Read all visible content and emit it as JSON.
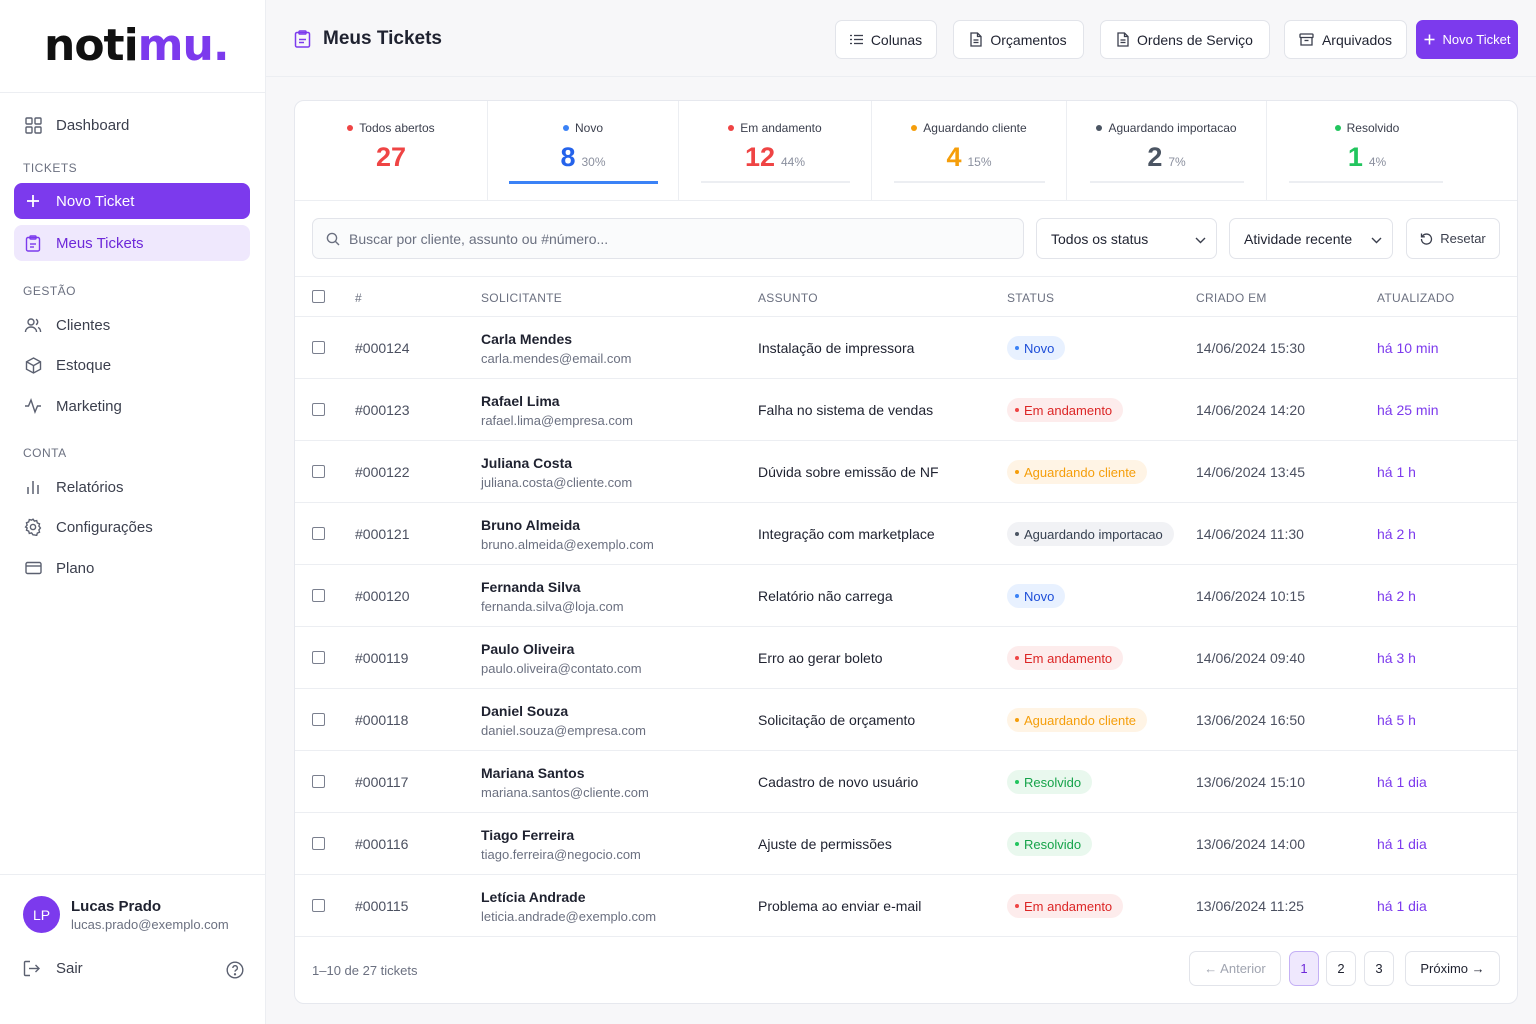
{
  "brand": {
    "logo_main": "noti",
    "logo_accent": "mu",
    "logo_dot": ".",
    "accent_color": "#7c3aed"
  },
  "sidebar": {
    "dashboard": "Dashboard",
    "section_tickets": "TICKETS",
    "novo_ticket": "Novo Ticket",
    "meus_tickets": "Meus Tickets",
    "section_gestao": "GESTÃO",
    "clientes": "Clientes",
    "estoque": "Estoque",
    "marketing": "Marketing",
    "section_conta": "CONTA",
    "relatorios": "Relatórios",
    "configuracoes": "Configurações",
    "plano": "Plano",
    "user": {
      "initials": "LP",
      "name": "Lucas Prado",
      "email": "lucas.prado@exemplo.com"
    },
    "logout": "Sair"
  },
  "header": {
    "title": "Meus Tickets",
    "buttons": {
      "colunas": "Colunas",
      "orcamentos": "Orçamentos",
      "ordens": "Ordens de Serviço",
      "arquivados": "Arquivados",
      "novo": "Novo Ticket"
    }
  },
  "stats": [
    {
      "label": "Todos abertos",
      "value": "27",
      "pct": "",
      "color": "#ef4444"
    },
    {
      "label": "Novo",
      "value": "8",
      "pct": "30%",
      "color": "#3b82f6"
    },
    {
      "label": "Em andamento",
      "value": "12",
      "pct": "44%",
      "color": "#ef4444"
    },
    {
      "label": "Aguardando cliente",
      "value": "4",
      "pct": "15%",
      "color": "#f59e0b"
    },
    {
      "label": "Aguardando importacao",
      "value": "2",
      "pct": "7%",
      "color": "#4b5563"
    },
    {
      "label": "Resolvido",
      "value": "1",
      "pct": "4%",
      "color": "#22c55e"
    }
  ],
  "filters": {
    "search_placeholder": "Buscar por cliente, assunto ou #número...",
    "status_select": "Todos os status",
    "sort_select": "Atividade recente",
    "reset": "Resetar"
  },
  "table": {
    "columns": [
      "#",
      "SOLICITANTE",
      "ASSUNTO",
      "STATUS",
      "CRIADO EM",
      "ATUALIZADO"
    ],
    "rows": [
      {
        "id": "#000124",
        "name": "Carla Mendes",
        "email": "carla.mendes@email.com",
        "subject": "Instalação de impressora",
        "status": "Novo",
        "status_kind": "novo",
        "created": "14/06/2024 15:30",
        "updated": "há 10 min"
      },
      {
        "id": "#000123",
        "name": "Rafael Lima",
        "email": "rafael.lima@empresa.com",
        "subject": "Falha no sistema de vendas",
        "status": "Em andamento",
        "status_kind": "andamento",
        "created": "14/06/2024 14:20",
        "updated": "há 25 min"
      },
      {
        "id": "#000122",
        "name": "Juliana Costa",
        "email": "juliana.costa@cliente.com",
        "subject": "Dúvida sobre emissão de NF",
        "status": "Aguardando cliente",
        "status_kind": "cliente",
        "created": "14/06/2024 13:45",
        "updated": "há 1 h"
      },
      {
        "id": "#000121",
        "name": "Bruno Almeida",
        "email": "bruno.almeida@exemplo.com",
        "subject": "Integração com marketplace",
        "status": "Aguardando importacao",
        "status_kind": "importacao",
        "created": "14/06/2024 11:30",
        "updated": "há 2 h"
      },
      {
        "id": "#000120",
        "name": "Fernanda Silva",
        "email": "fernanda.silva@loja.com",
        "subject": "Relatório não carrega",
        "status": "Novo",
        "status_kind": "novo",
        "created": "14/06/2024 10:15",
        "updated": "há 2 h"
      },
      {
        "id": "#000119",
        "name": "Paulo Oliveira",
        "email": "paulo.oliveira@contato.com",
        "subject": "Erro ao gerar boleto",
        "status": "Em andamento",
        "status_kind": "andamento",
        "created": "14/06/2024 09:40",
        "updated": "há 3 h"
      },
      {
        "id": "#000118",
        "name": "Daniel Souza",
        "email": "daniel.souza@empresa.com",
        "subject": "Solicitação de orçamento",
        "status": "Aguardando cliente",
        "status_kind": "cliente",
        "created": "13/06/2024 16:50",
        "updated": "há 5 h"
      },
      {
        "id": "#000117",
        "name": "Mariana Santos",
        "email": "mariana.santos@cliente.com",
        "subject": "Cadastro de novo usuário",
        "status": "Resolvido",
        "status_kind": "resolvido",
        "created": "13/06/2024 15:10",
        "updated": "há 1 dia"
      },
      {
        "id": "#000116",
        "name": "Tiago Ferreira",
        "email": "tiago.ferreira@negocio.com",
        "subject": "Ajuste de permissões",
        "status": "Resolvido",
        "status_kind": "resolvido",
        "created": "13/06/2024 14:00",
        "updated": "há 1 dia"
      },
      {
        "id": "#000115",
        "name": "Letícia Andrade",
        "email": "leticia.andrade@exemplo.com",
        "subject": "Problema ao enviar e-mail",
        "status": "Em andamento",
        "status_kind": "andamento",
        "created": "13/06/2024 11:25",
        "updated": "há 1 dia"
      }
    ]
  },
  "status_styles": {
    "novo": {
      "bg": "#e8f1ff",
      "fg": "#1d4ed8",
      "dot": "#3b82f6"
    },
    "andamento": {
      "bg": "#fdecec",
      "fg": "#dc2626",
      "dot": "#ef4444"
    },
    "cliente": {
      "bg": "#fff4e5",
      "fg": "#f59e0b",
      "dot": "#f59e0b"
    },
    "importacao": {
      "bg": "#f1f2f5",
      "fg": "#374151",
      "dot": "#4b5563"
    },
    "resolvido": {
      "bg": "#e9f8ee",
      "fg": "#16a34a",
      "dot": "#22c55e"
    }
  },
  "pagination": {
    "summary": "1–10 de 27 tickets",
    "prev": "← Anterior",
    "pages": [
      "1",
      "2",
      "3"
    ],
    "current": "1",
    "next": "Próximo →"
  }
}
